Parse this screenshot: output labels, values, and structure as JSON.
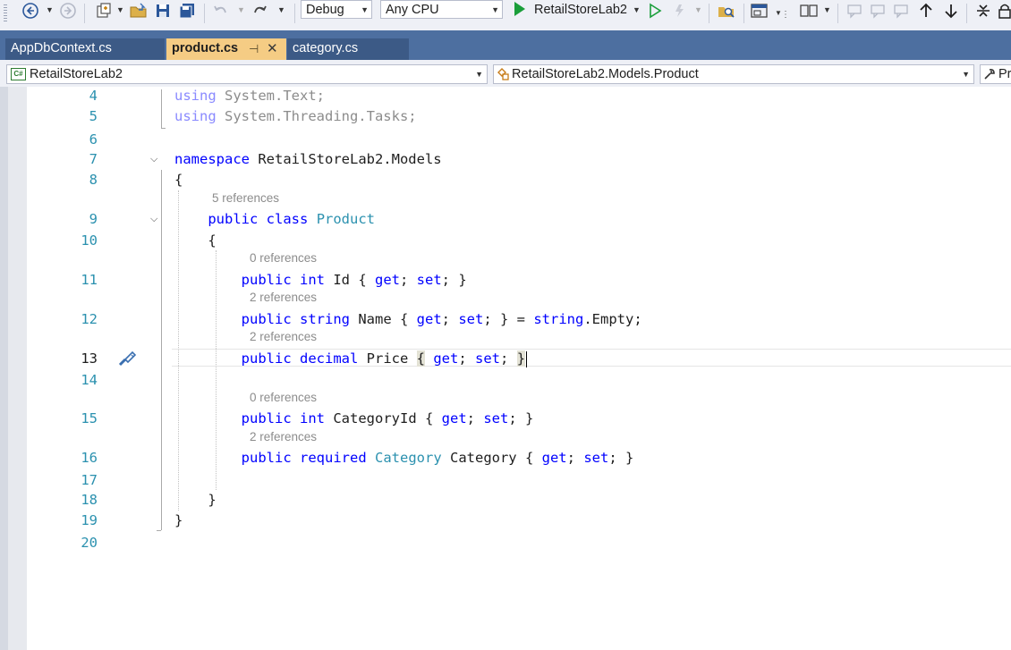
{
  "toolbar": {
    "config_value": "Debug",
    "platform_value": "Any CPU",
    "run_target": "RetailStoreLab2"
  },
  "tabs": [
    {
      "label": "AppDbContext.cs",
      "active": false
    },
    {
      "label": "product.cs",
      "active": true
    },
    {
      "label": "category.cs",
      "active": false
    }
  ],
  "navbar": {
    "project": "RetailStoreLab2",
    "type": "RetailStoreLab2.Models.Product",
    "member": "Pr"
  },
  "editor": {
    "lines": [
      {
        "n": "4",
        "code": [
          {
            "t": "using",
            "c": "kw-dim"
          },
          {
            "t": " System.Text;",
            "c": "dim"
          }
        ]
      },
      {
        "n": "5",
        "code": [
          {
            "t": "using",
            "c": "kw-dim"
          },
          {
            "t": " System.Threading.Tasks;",
            "c": "dim"
          }
        ]
      },
      {
        "n": "6",
        "code": []
      },
      {
        "n": "7",
        "code": [
          {
            "t": "namespace",
            "c": "kw"
          },
          {
            "t": " RetailStoreLab2.Models"
          }
        ]
      },
      {
        "n": "8",
        "code": [
          {
            "t": "{"
          }
        ]
      },
      {
        "n": "9",
        "lens": "5 references",
        "code": [
          {
            "t": "    "
          },
          {
            "t": "public",
            "c": "kw"
          },
          {
            "t": " "
          },
          {
            "t": "class",
            "c": "kw"
          },
          {
            "t": " "
          },
          {
            "t": "Product",
            "c": "ty"
          }
        ]
      },
      {
        "n": "10",
        "code": [
          {
            "t": "    {"
          }
        ]
      },
      {
        "n": "11",
        "lens": "0 references",
        "code": [
          {
            "t": "        "
          },
          {
            "t": "public",
            "c": "kw"
          },
          {
            "t": " "
          },
          {
            "t": "int",
            "c": "kw"
          },
          {
            "t": " Id { "
          },
          {
            "t": "get",
            "c": "kw"
          },
          {
            "t": "; "
          },
          {
            "t": "set",
            "c": "kw"
          },
          {
            "t": "; }"
          }
        ]
      },
      {
        "n": "12",
        "lens": "2 references",
        "code": [
          {
            "t": "        "
          },
          {
            "t": "public",
            "c": "kw"
          },
          {
            "t": " "
          },
          {
            "t": "string",
            "c": "kw"
          },
          {
            "t": " Name { "
          },
          {
            "t": "get",
            "c": "kw"
          },
          {
            "t": "; "
          },
          {
            "t": "set",
            "c": "kw"
          },
          {
            "t": "; } = "
          },
          {
            "t": "string",
            "c": "kw"
          },
          {
            "t": ".Empty;"
          }
        ]
      },
      {
        "n": "13",
        "lens": "2 references",
        "current": true,
        "code": [
          {
            "t": "        "
          },
          {
            "t": "public",
            "c": "kw"
          },
          {
            "t": " "
          },
          {
            "t": "decimal",
            "c": "kw"
          },
          {
            "t": " Price "
          },
          {
            "t": "{",
            "c": "brace-hl"
          },
          {
            "t": " "
          },
          {
            "t": "get",
            "c": "kw"
          },
          {
            "t": "; "
          },
          {
            "t": "set",
            "c": "kw"
          },
          {
            "t": "; "
          },
          {
            "t": "}",
            "c": "brace-hl"
          }
        ]
      },
      {
        "n": "14",
        "code": []
      },
      {
        "n": "15",
        "lens": "0 references",
        "code": [
          {
            "t": "        "
          },
          {
            "t": "public",
            "c": "kw"
          },
          {
            "t": " "
          },
          {
            "t": "int",
            "c": "kw"
          },
          {
            "t": " CategoryId { "
          },
          {
            "t": "get",
            "c": "kw"
          },
          {
            "t": "; "
          },
          {
            "t": "set",
            "c": "kw"
          },
          {
            "t": "; }"
          }
        ]
      },
      {
        "n": "16",
        "lens": "2 references",
        "code": [
          {
            "t": "        "
          },
          {
            "t": "public",
            "c": "kw"
          },
          {
            "t": " "
          },
          {
            "t": "required",
            "c": "kw"
          },
          {
            "t": " "
          },
          {
            "t": "Category",
            "c": "ty"
          },
          {
            "t": " Category { "
          },
          {
            "t": "get",
            "c": "kw"
          },
          {
            "t": "; "
          },
          {
            "t": "set",
            "c": "kw"
          },
          {
            "t": "; }"
          }
        ]
      },
      {
        "n": "17",
        "code": []
      },
      {
        "n": "18",
        "code": [
          {
            "t": "    }"
          }
        ]
      },
      {
        "n": "19",
        "code": [
          {
            "t": "}"
          }
        ]
      },
      {
        "n": "20",
        "code": []
      }
    ]
  }
}
